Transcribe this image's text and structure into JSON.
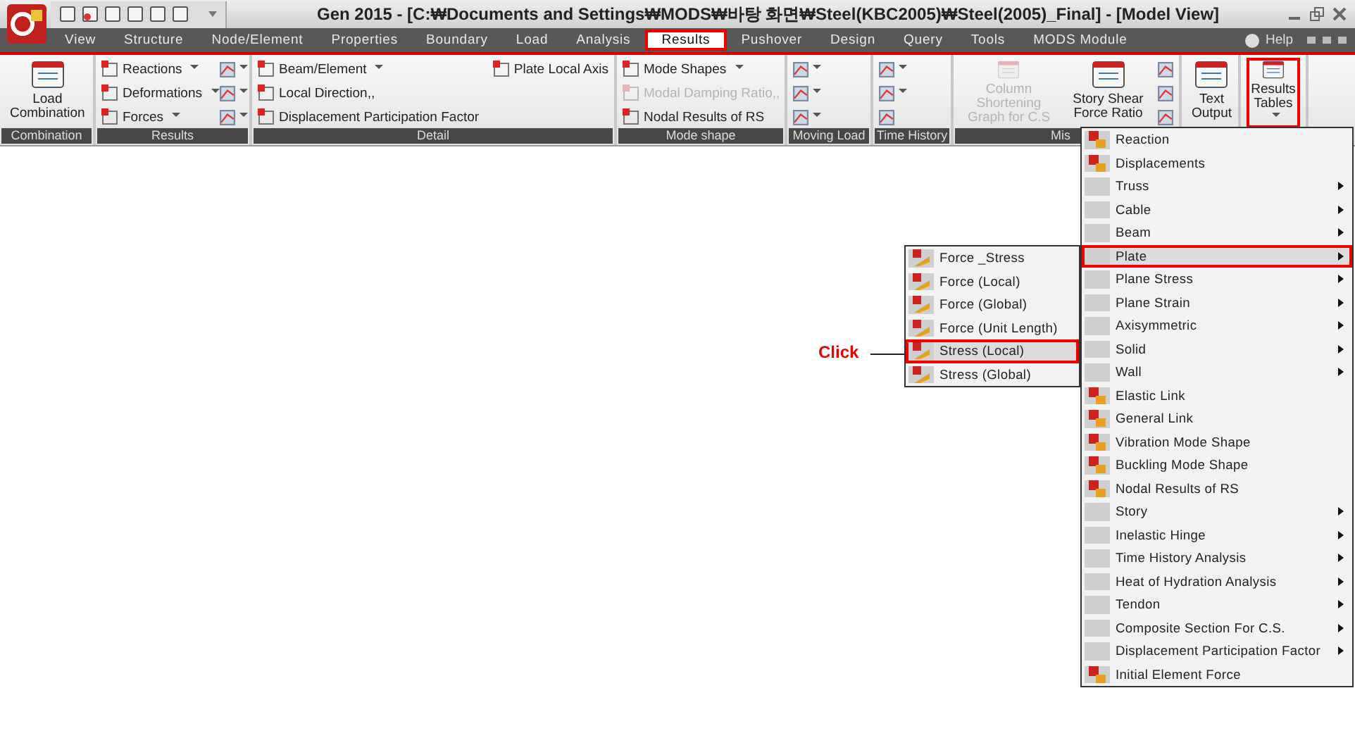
{
  "window": {
    "title": "Gen 2015 - [C:₩Documents and Settings₩MODS₩바탕 화면₩Steel(KBC2005)₩Steel(2005)_Final] - [Model View]"
  },
  "tabs": [
    {
      "label": "View",
      "selected": false
    },
    {
      "label": "Structure",
      "selected": false
    },
    {
      "label": "Node/Element",
      "selected": false
    },
    {
      "label": "Properties",
      "selected": false
    },
    {
      "label": "Boundary",
      "selected": false
    },
    {
      "label": "Load",
      "selected": false
    },
    {
      "label": "Analysis",
      "selected": false
    },
    {
      "label": "Results",
      "selected": true
    },
    {
      "label": "Pushover",
      "selected": false
    },
    {
      "label": "Design",
      "selected": false
    },
    {
      "label": "Query",
      "selected": false
    },
    {
      "label": "Tools",
      "selected": false
    },
    {
      "label": "MODS Module",
      "selected": false
    }
  ],
  "help": {
    "label": "Help"
  },
  "ribbon": [
    {
      "label": "Combination",
      "columns": [
        [
          {
            "kind": "large",
            "label": "Load Combination"
          }
        ]
      ]
    },
    {
      "label": "Results",
      "columns": [
        [
          {
            "kind": "small",
            "label": "Reactions",
            "dropdown": true
          },
          {
            "kind": "small",
            "label": "Deformations",
            "dropdown": true
          },
          {
            "kind": "small",
            "label": "Forces",
            "dropdown": true
          }
        ],
        [
          {
            "kind": "icon",
            "dropdown": true
          },
          {
            "kind": "icon",
            "dropdown": true
          },
          {
            "kind": "icon",
            "dropdown": true
          }
        ]
      ]
    },
    {
      "label": "Detail",
      "columns": [
        [
          {
            "kind": "small",
            "label": "Beam/Element",
            "dropdown": true
          },
          {
            "kind": "small",
            "label": "Local Direction,,"
          },
          {
            "kind": "small",
            "label": "Displacement Participation Factor"
          }
        ],
        [
          {
            "kind": "small",
            "label": "Plate Local Axis"
          }
        ]
      ]
    },
    {
      "label": "Mode shape",
      "columns": [
        [
          {
            "kind": "small",
            "label": "Mode Shapes",
            "dropdown": true
          },
          {
            "kind": "small",
            "label": "Modal Damping Ratio,,",
            "disabled": true
          },
          {
            "kind": "small",
            "label": "Nodal Results of RS"
          }
        ]
      ]
    },
    {
      "label": "Moving Load",
      "columns": [
        [
          {
            "kind": "icon",
            "dropdown": true
          },
          {
            "kind": "icon",
            "dropdown": true
          },
          {
            "kind": "icon",
            "dropdown": true
          }
        ]
      ]
    },
    {
      "label": "Time History",
      "columns": [
        [
          {
            "kind": "icon",
            "dropdown": true
          },
          {
            "kind": "icon",
            "dropdown": true
          },
          {
            "kind": "icon"
          }
        ]
      ]
    },
    {
      "label": "Mis",
      "columns": [
        [
          {
            "kind": "large",
            "label": "Column Shortening Graph for C.S",
            "disabled": true
          }
        ],
        [
          {
            "kind": "large",
            "label": "Story Shear Force Ratio"
          }
        ],
        [
          {
            "kind": "icon"
          },
          {
            "kind": "icon"
          },
          {
            "kind": "icon"
          }
        ]
      ]
    },
    {
      "columns": [
        [
          {
            "kind": "large",
            "label": "Text Output"
          }
        ]
      ]
    },
    {
      "columns": [
        [
          {
            "kind": "large",
            "label": "Results Tables",
            "dropdown": true,
            "highlighted": true
          }
        ]
      ]
    }
  ],
  "results_menu": [
    {
      "label": "Reaction",
      "kind": "command",
      "selected": false
    },
    {
      "label": "Displacements",
      "kind": "command",
      "selected": false
    },
    {
      "label": "Truss",
      "kind": "submenu",
      "selected": false
    },
    {
      "label": "Cable",
      "kind": "submenu",
      "selected": false
    },
    {
      "label": "Beam",
      "kind": "submenu",
      "selected": false
    },
    {
      "label": "Plate",
      "kind": "submenu",
      "selected": true
    },
    {
      "label": "Plane Stress",
      "kind": "submenu",
      "selected": false
    },
    {
      "label": "Plane Strain",
      "kind": "submenu",
      "selected": false
    },
    {
      "label": "Axisymmetric",
      "kind": "submenu",
      "selected": false
    },
    {
      "label": "Solid",
      "kind": "submenu",
      "selected": false
    },
    {
      "label": "Wall",
      "kind": "submenu",
      "selected": false
    },
    {
      "label": "Elastic Link",
      "kind": "command",
      "selected": false
    },
    {
      "label": "General Link",
      "kind": "command",
      "selected": false
    },
    {
      "label": "Vibration Mode Shape",
      "kind": "command",
      "selected": false
    },
    {
      "label": "Buckling Mode Shape",
      "kind": "command",
      "selected": false
    },
    {
      "label": "Nodal Results of RS",
      "kind": "command",
      "selected": false
    },
    {
      "label": "Story",
      "kind": "submenu",
      "selected": false
    },
    {
      "label": "Inelastic Hinge",
      "kind": "submenu",
      "selected": false
    },
    {
      "label": "Time History Analysis",
      "kind": "submenu",
      "selected": false
    },
    {
      "label": "Heat of Hydration Analysis",
      "kind": "submenu",
      "selected": false
    },
    {
      "label": "Tendon",
      "kind": "submenu",
      "selected": false
    },
    {
      "label": "Composite Section For C.S.",
      "kind": "submenu",
      "selected": false
    },
    {
      "label": "Displacement Participation Factor",
      "kind": "submenu",
      "selected": false
    },
    {
      "label": "Initial Element Force",
      "kind": "command",
      "selected": false
    }
  ],
  "plate_submenu": [
    {
      "label": "Force _Stress",
      "selected": false
    },
    {
      "label": "Force (Local)",
      "selected": false
    },
    {
      "label": "Force (Global)",
      "selected": false
    },
    {
      "label": "Force (Unit Length)",
      "selected": false
    },
    {
      "label": "Stress (Local)",
      "selected": true
    },
    {
      "label": "Stress (Global)",
      "selected": false
    }
  ],
  "annotation": {
    "label": "Click"
  }
}
